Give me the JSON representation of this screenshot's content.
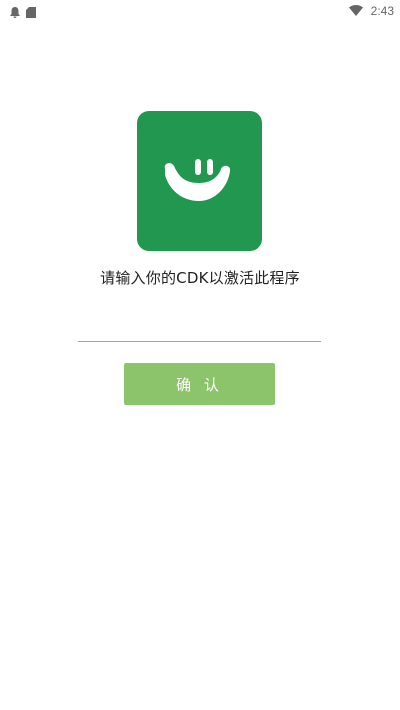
{
  "status_bar": {
    "time": "2:43",
    "left_icons": [
      "notification-bell-icon",
      "sd-card-icon"
    ],
    "right_icons": [
      "wifi-icon"
    ]
  },
  "app_icon": {
    "background_color": "#219750",
    "icon_name": "smiley-logo-icon"
  },
  "activation": {
    "prompt": "请输入你的CDK以激活此程序",
    "input_value": "",
    "input_placeholder": "",
    "confirm_label": "确 认",
    "accent_color": "#8bc34a"
  }
}
